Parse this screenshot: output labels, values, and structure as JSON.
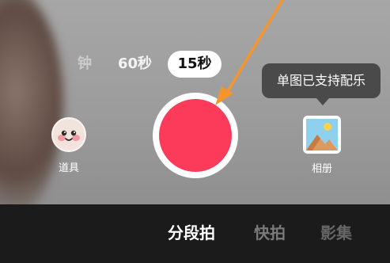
{
  "duration_tabs": {
    "minute_partial": "钟",
    "sixty_seconds": "60秒",
    "fifteen_seconds": "15秒"
  },
  "tooltip": {
    "text": "单图已支持配乐"
  },
  "effects": {
    "label": "道具",
    "icon": "face-sticker-icon"
  },
  "album": {
    "label": "相册",
    "icon": "image-gallery-icon"
  },
  "modes": {
    "segment": "分段拍",
    "quick": "快拍",
    "album": "影集"
  },
  "colors": {
    "record": "#fc3b5a",
    "arrow": "#f5962d",
    "tooltip_bg": "#4a4a4a",
    "bottom_bar": "#1b1b1b"
  }
}
